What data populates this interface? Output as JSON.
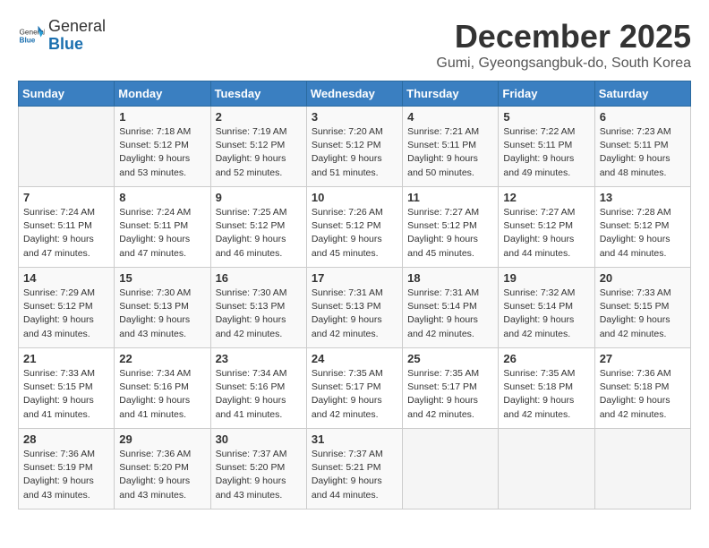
{
  "header": {
    "logo_general": "General",
    "logo_blue": "Blue",
    "month": "December 2025",
    "location": "Gumi, Gyeongsangbuk-do, South Korea"
  },
  "weekdays": [
    "Sunday",
    "Monday",
    "Tuesday",
    "Wednesday",
    "Thursday",
    "Friday",
    "Saturday"
  ],
  "weeks": [
    [
      {
        "day": "",
        "info": ""
      },
      {
        "day": "1",
        "info": "Sunrise: 7:18 AM\nSunset: 5:12 PM\nDaylight: 9 hours\nand 53 minutes."
      },
      {
        "day": "2",
        "info": "Sunrise: 7:19 AM\nSunset: 5:12 PM\nDaylight: 9 hours\nand 52 minutes."
      },
      {
        "day": "3",
        "info": "Sunrise: 7:20 AM\nSunset: 5:12 PM\nDaylight: 9 hours\nand 51 minutes."
      },
      {
        "day": "4",
        "info": "Sunrise: 7:21 AM\nSunset: 5:11 PM\nDaylight: 9 hours\nand 50 minutes."
      },
      {
        "day": "5",
        "info": "Sunrise: 7:22 AM\nSunset: 5:11 PM\nDaylight: 9 hours\nand 49 minutes."
      },
      {
        "day": "6",
        "info": "Sunrise: 7:23 AM\nSunset: 5:11 PM\nDaylight: 9 hours\nand 48 minutes."
      }
    ],
    [
      {
        "day": "7",
        "info": "Sunrise: 7:24 AM\nSunset: 5:11 PM\nDaylight: 9 hours\nand 47 minutes."
      },
      {
        "day": "8",
        "info": "Sunrise: 7:24 AM\nSunset: 5:11 PM\nDaylight: 9 hours\nand 47 minutes."
      },
      {
        "day": "9",
        "info": "Sunrise: 7:25 AM\nSunset: 5:12 PM\nDaylight: 9 hours\nand 46 minutes."
      },
      {
        "day": "10",
        "info": "Sunrise: 7:26 AM\nSunset: 5:12 PM\nDaylight: 9 hours\nand 45 minutes."
      },
      {
        "day": "11",
        "info": "Sunrise: 7:27 AM\nSunset: 5:12 PM\nDaylight: 9 hours\nand 45 minutes."
      },
      {
        "day": "12",
        "info": "Sunrise: 7:27 AM\nSunset: 5:12 PM\nDaylight: 9 hours\nand 44 minutes."
      },
      {
        "day": "13",
        "info": "Sunrise: 7:28 AM\nSunset: 5:12 PM\nDaylight: 9 hours\nand 44 minutes."
      }
    ],
    [
      {
        "day": "14",
        "info": "Sunrise: 7:29 AM\nSunset: 5:12 PM\nDaylight: 9 hours\nand 43 minutes."
      },
      {
        "day": "15",
        "info": "Sunrise: 7:30 AM\nSunset: 5:13 PM\nDaylight: 9 hours\nand 43 minutes."
      },
      {
        "day": "16",
        "info": "Sunrise: 7:30 AM\nSunset: 5:13 PM\nDaylight: 9 hours\nand 42 minutes."
      },
      {
        "day": "17",
        "info": "Sunrise: 7:31 AM\nSunset: 5:13 PM\nDaylight: 9 hours\nand 42 minutes."
      },
      {
        "day": "18",
        "info": "Sunrise: 7:31 AM\nSunset: 5:14 PM\nDaylight: 9 hours\nand 42 minutes."
      },
      {
        "day": "19",
        "info": "Sunrise: 7:32 AM\nSunset: 5:14 PM\nDaylight: 9 hours\nand 42 minutes."
      },
      {
        "day": "20",
        "info": "Sunrise: 7:33 AM\nSunset: 5:15 PM\nDaylight: 9 hours\nand 42 minutes."
      }
    ],
    [
      {
        "day": "21",
        "info": "Sunrise: 7:33 AM\nSunset: 5:15 PM\nDaylight: 9 hours\nand 41 minutes."
      },
      {
        "day": "22",
        "info": "Sunrise: 7:34 AM\nSunset: 5:16 PM\nDaylight: 9 hours\nand 41 minutes."
      },
      {
        "day": "23",
        "info": "Sunrise: 7:34 AM\nSunset: 5:16 PM\nDaylight: 9 hours\nand 41 minutes."
      },
      {
        "day": "24",
        "info": "Sunrise: 7:35 AM\nSunset: 5:17 PM\nDaylight: 9 hours\nand 42 minutes."
      },
      {
        "day": "25",
        "info": "Sunrise: 7:35 AM\nSunset: 5:17 PM\nDaylight: 9 hours\nand 42 minutes."
      },
      {
        "day": "26",
        "info": "Sunrise: 7:35 AM\nSunset: 5:18 PM\nDaylight: 9 hours\nand 42 minutes."
      },
      {
        "day": "27",
        "info": "Sunrise: 7:36 AM\nSunset: 5:18 PM\nDaylight: 9 hours\nand 42 minutes."
      }
    ],
    [
      {
        "day": "28",
        "info": "Sunrise: 7:36 AM\nSunset: 5:19 PM\nDaylight: 9 hours\nand 43 minutes."
      },
      {
        "day": "29",
        "info": "Sunrise: 7:36 AM\nSunset: 5:20 PM\nDaylight: 9 hours\nand 43 minutes."
      },
      {
        "day": "30",
        "info": "Sunrise: 7:37 AM\nSunset: 5:20 PM\nDaylight: 9 hours\nand 43 minutes."
      },
      {
        "day": "31",
        "info": "Sunrise: 7:37 AM\nSunset: 5:21 PM\nDaylight: 9 hours\nand 44 minutes."
      },
      {
        "day": "",
        "info": ""
      },
      {
        "day": "",
        "info": ""
      },
      {
        "day": "",
        "info": ""
      }
    ]
  ]
}
